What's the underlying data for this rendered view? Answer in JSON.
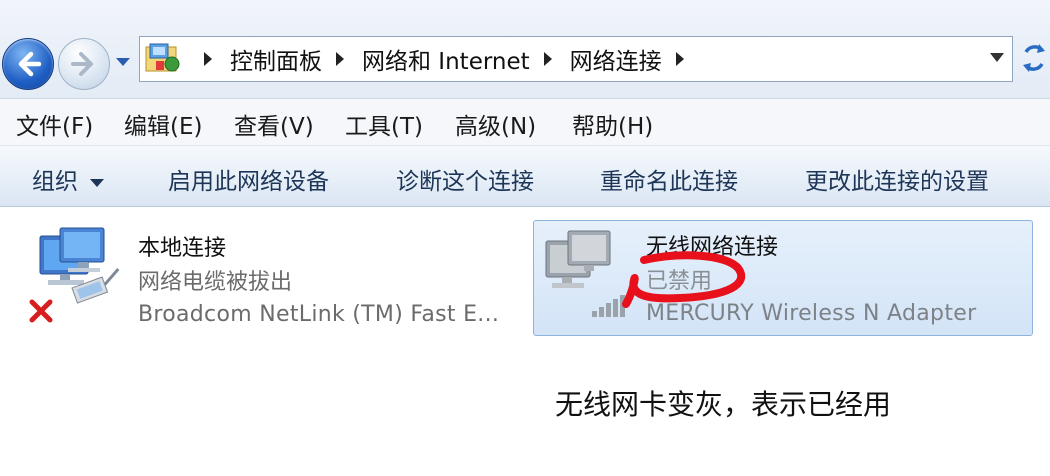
{
  "address_bar": {
    "crumbs": [
      "控制面板",
      "网络和 Internet",
      "网络连接"
    ]
  },
  "menu": {
    "items": [
      "文件(F)",
      "编辑(E)",
      "查看(V)",
      "工具(T)",
      "高级(N)",
      "帮助(H)"
    ]
  },
  "commands": {
    "organize": "组织",
    "enable": "启用此网络设备",
    "diagnose": "诊断这个连接",
    "rename": "重命名此连接",
    "change_settings": "更改此连接的设置"
  },
  "connections": [
    {
      "name": "本地连接",
      "status": "网络电缆被拔出",
      "device": "Broadcom NetLink (TM) Fast E..."
    },
    {
      "name": "无线网络连接",
      "status": "已禁用",
      "device": "MERCURY Wireless N Adapter"
    }
  ],
  "annotation": "无线网卡变灰，表示已经用",
  "colors": {
    "highlight_circle": "#e8101a",
    "selection_bg": "#dbe8f8",
    "command_text": "#1d3557"
  }
}
